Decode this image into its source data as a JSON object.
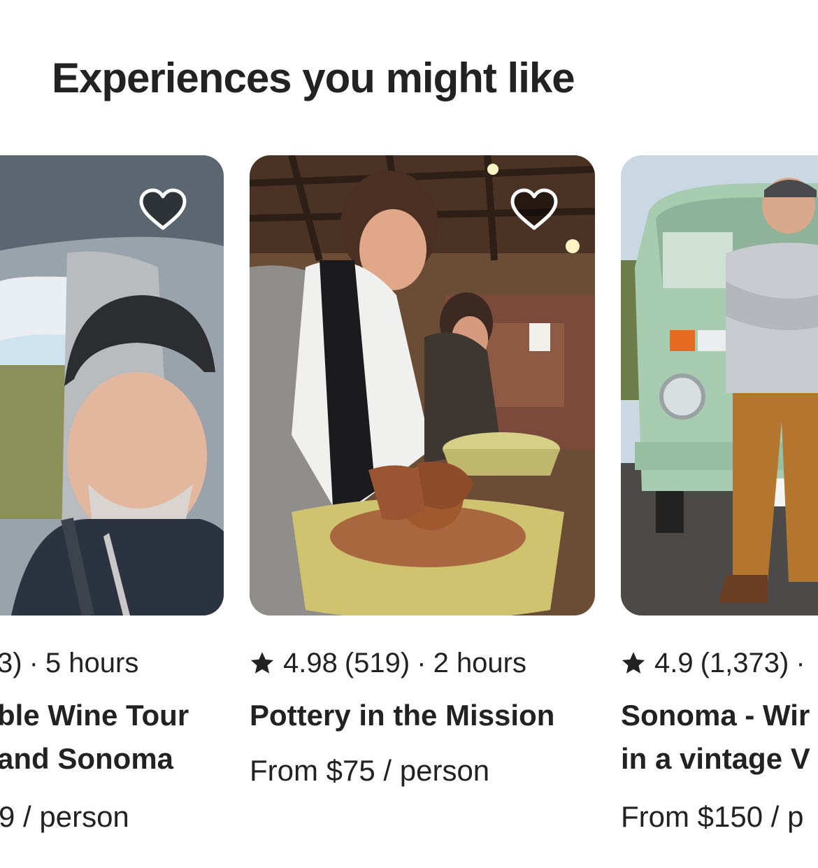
{
  "section": {
    "title": "Experiences you might like"
  },
  "cards": [
    {
      "rating": "",
      "reviews": "(…3)",
      "reviews_visible": "3)",
      "duration": "5 hours",
      "title": "…ble Wine Tour …and Sonoma",
      "title_line1": "ble Wine Tour",
      "title_line2": "and Sonoma",
      "price": "9 / person",
      "photo_icon": "photo-man-in-car-selfie",
      "wishlist_icon": "heart-icon"
    },
    {
      "rating": "4.98",
      "reviews": "(519)",
      "duration": "2 hours",
      "title": "Pottery in the Mission",
      "price": "From $75 / person",
      "photo_icon": "photo-pottery-class",
      "wishlist_icon": "heart-icon"
    },
    {
      "rating": "4.9",
      "reviews": "(1,373)",
      "duration": "",
      "title_line1": "Sonoma - Wir",
      "title_line2": "in a vintage V",
      "price": "From $150 / p",
      "photo_icon": "photo-man-with-vintage-van",
      "wishlist_icon": "heart-icon"
    }
  ],
  "separator": "·",
  "colors": {
    "text": "#222222",
    "background": "#ffffff",
    "heart_fill": "rgba(0,0,0,0.5)",
    "heart_stroke": "#ffffff"
  }
}
